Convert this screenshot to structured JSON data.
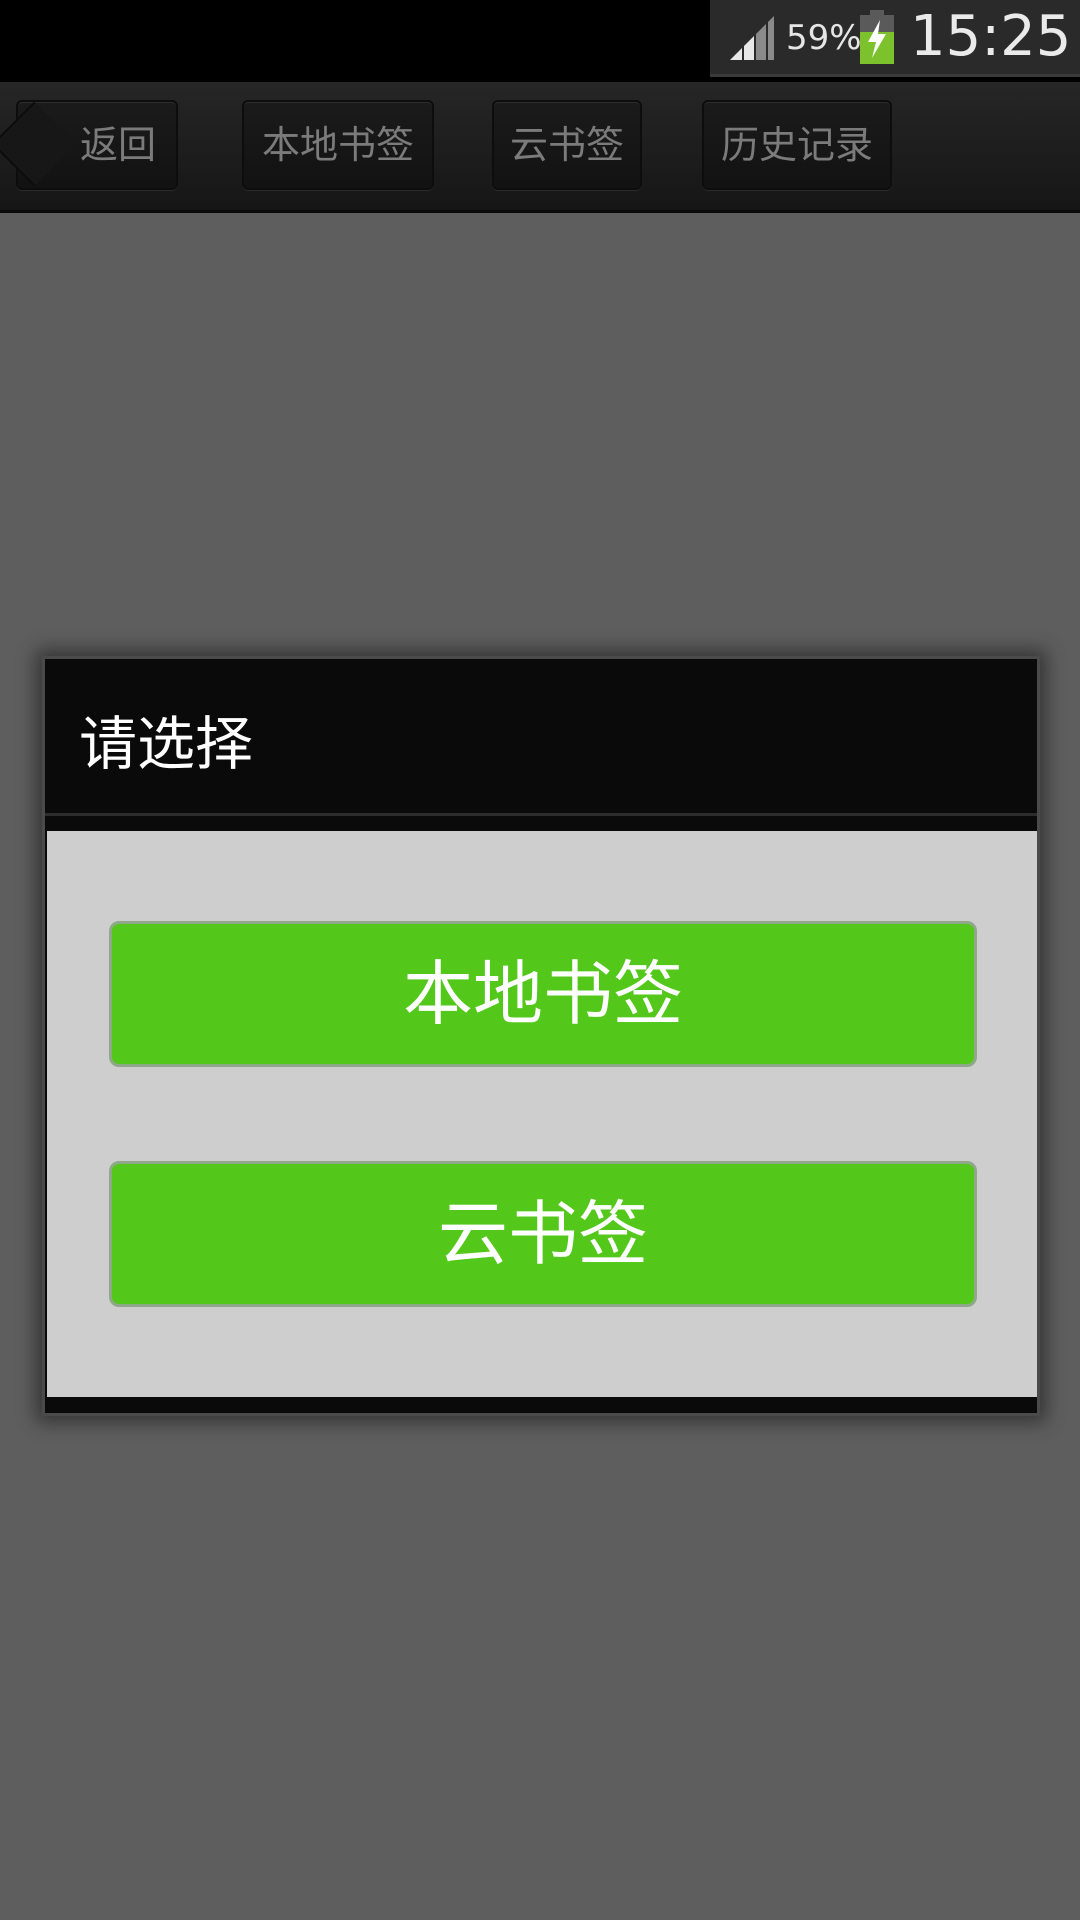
{
  "status_bar": {
    "battery_percent": "59%",
    "time": "15:25",
    "icons": [
      "signal-icon",
      "battery-charging-icon"
    ],
    "battery_color": "#7cc22c"
  },
  "toolbar": {
    "back_label": "返回",
    "local_bookmarks_label": "本地书签",
    "cloud_bookmarks_label": "云书签",
    "history_label": "历史记录"
  },
  "dialog": {
    "title": "请选择",
    "options": [
      {
        "label": "本地书签"
      },
      {
        "label": "云书签"
      }
    ],
    "button_color": "#53c81a"
  }
}
